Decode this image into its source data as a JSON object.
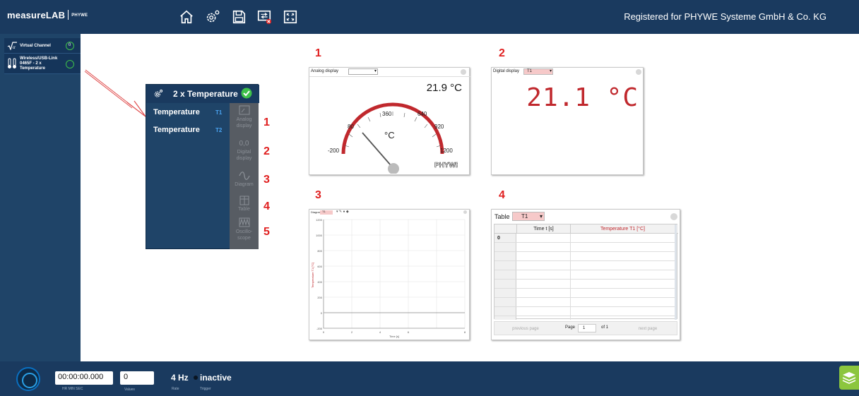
{
  "app": {
    "brand": "measureLAB",
    "brand_small": "PHYWE",
    "registered": "Registered for PHYWE Systeme GmbH & Co. KG"
  },
  "toolbar": {
    "icons": [
      "home-icon",
      "settings-icon",
      "save-icon",
      "screen-close-icon",
      "fullscreen-icon"
    ]
  },
  "sidebar": {
    "items": [
      {
        "label": "Virtual Channel",
        "icon": "sqrt-alpha-icon",
        "badge": "0"
      },
      {
        "label": "Wireless/USB-Link 0465F - 2 x Temperature",
        "icon": "thermometer-icon"
      }
    ]
  },
  "popup": {
    "title": "2 x Temperature",
    "rows": [
      {
        "label": "Temperature",
        "channel": "T1"
      },
      {
        "label": "Temperature",
        "channel": "T2"
      }
    ],
    "options": [
      {
        "label": "Analog display",
        "icon": "analog-display-icon"
      },
      {
        "label": "Digital display",
        "symbol": "0,0",
        "icon": "digital-display-icon"
      },
      {
        "label": "Diagram",
        "icon": "diagram-icon"
      },
      {
        "label": "Table",
        "icon": "table-icon"
      },
      {
        "label": "Oscillo-scope",
        "icon": "oscilloscope-icon"
      }
    ],
    "numbers": [
      "1",
      "2",
      "3",
      "4",
      "5"
    ]
  },
  "panels": {
    "analog": {
      "number": "1",
      "title": "Analog display",
      "value": "21.9 °C",
      "unit": "°C",
      "scale_labels": [
        "-200",
        "80",
        "360",
        "640",
        "920",
        "1200"
      ],
      "logo": "PHYWE"
    },
    "digital": {
      "number": "2",
      "title": "Digital display",
      "channel": "T1",
      "value": "21.1 °C"
    },
    "diagram": {
      "number": "3",
      "title": "Diagram",
      "channel": "T1",
      "ylabel": "Temperature T1 [°C]",
      "xlabel": "Time [s]",
      "yticks": [
        "1200",
        "1000",
        "800",
        "600",
        "400",
        "200",
        "0",
        "-200"
      ],
      "xticks": [
        "0",
        "2",
        "4",
        "6",
        "8"
      ]
    },
    "table": {
      "number": "4",
      "title": "Table",
      "channel": "T1",
      "columns": [
        "Time t [s]",
        "Temperature T1 [°C]"
      ],
      "first_row_index": "0",
      "prev": "previous page",
      "page_label": "Page",
      "page_value": "1",
      "of": "of 1",
      "next": "next page"
    }
  },
  "bottom": {
    "time": "00:00:00.000",
    "time_units": "HR    MIN    SEC",
    "values": "0",
    "values_label": "Values",
    "rate": "4 Hz",
    "rate_label": "Rate",
    "status": "inactive",
    "trigger_label": "Trigger"
  },
  "colors": {
    "topbar": "#1a3a5f",
    "sidebar": "#1f4468",
    "accent_red": "#e02020",
    "digital_red": "#c0282d",
    "ok_green": "#3ec04a",
    "channel_blue": "#4aa3f0"
  }
}
